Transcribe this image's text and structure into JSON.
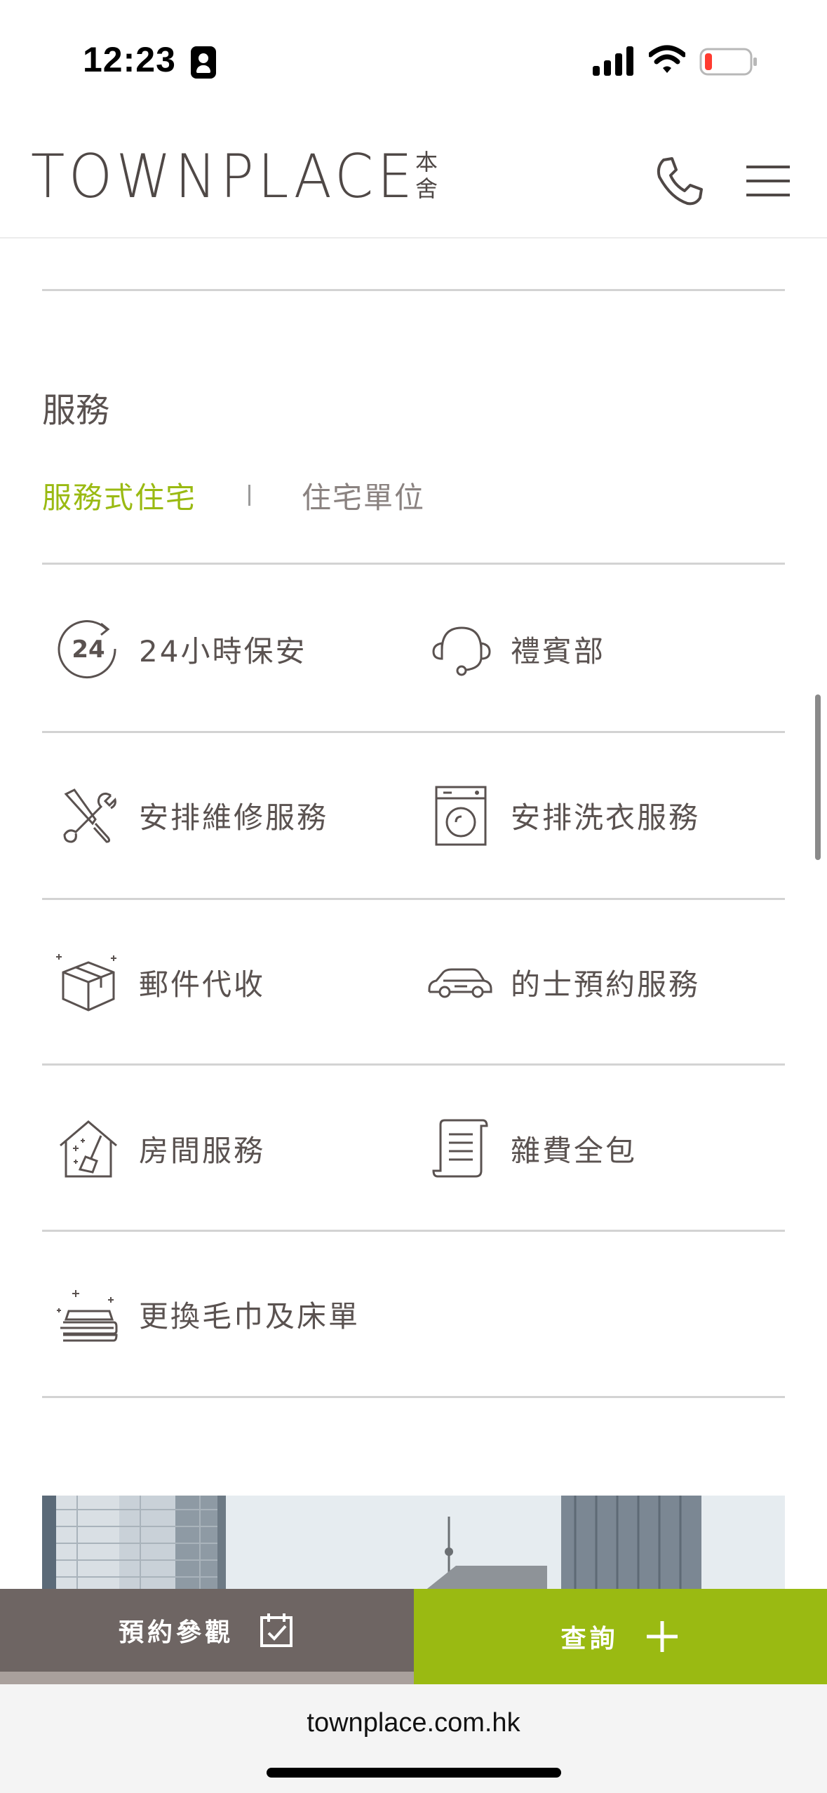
{
  "status_bar": {
    "time": "12:23"
  },
  "header": {
    "logo_text": "TOWNPLACE",
    "logo_cn": "本舍"
  },
  "section": {
    "title": "服務"
  },
  "tabs": [
    {
      "label": "服務式住宅",
      "active": true
    },
    {
      "label": "住宅單位",
      "active": false
    }
  ],
  "services": [
    {
      "label": "24小時保安",
      "icon": "24-hour-icon"
    },
    {
      "label": "禮賓部",
      "icon": "headset-icon"
    },
    {
      "label": "安排維修服務",
      "icon": "tools-icon"
    },
    {
      "label": "安排洗衣服務",
      "icon": "washing-machine-icon"
    },
    {
      "label": "郵件代收",
      "icon": "package-icon"
    },
    {
      "label": "的士預約服務",
      "icon": "car-icon"
    },
    {
      "label": "房間服務",
      "icon": "house-cleaning-icon"
    },
    {
      "label": "雜費全包",
      "icon": "receipt-icon"
    },
    {
      "label": "更換毛巾及床單",
      "icon": "towels-icon"
    }
  ],
  "cta": {
    "booking_label": "預約參觀",
    "enquiry_label": "查詢"
  },
  "browser": {
    "url": "townplace.com.hk"
  },
  "colors": {
    "accent_green": "#9aba12",
    "cta_gray": "#6e6563",
    "text": "#5a5250"
  }
}
